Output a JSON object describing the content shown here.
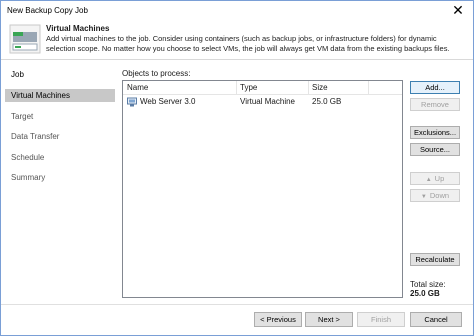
{
  "window": {
    "title": "New Backup Copy Job"
  },
  "header": {
    "title": "Virtual Machines",
    "description": "Add virtual machines to the job. Consider using containers (such as backup jobs, or infrastructure folders) for dynamic selection scope. No matter how you choose to select VMs, the job will always get VM data from the existing backups files."
  },
  "sidebar": {
    "items": [
      {
        "label": "Job"
      },
      {
        "label": "Virtual Machines"
      },
      {
        "label": "Target"
      },
      {
        "label": "Data Transfer"
      },
      {
        "label": "Schedule"
      },
      {
        "label": "Summary"
      }
    ]
  },
  "objects": {
    "label": "Objects to process:",
    "columns": [
      "Name",
      "Type",
      "Size"
    ],
    "rows": [
      {
        "name": "Web Server 3.0",
        "type": "Virtual Machine",
        "size": "25.0 GB"
      }
    ]
  },
  "side_buttons": {
    "add": "Add...",
    "remove": "Remove",
    "exclusions": "Exclusions...",
    "source": "Source...",
    "up": "Up",
    "down": "Down",
    "recalculate": "Recalculate"
  },
  "total": {
    "label": "Total size:",
    "value": "25.0 GB"
  },
  "footer": {
    "previous": "< Previous",
    "next": "Next >",
    "finish": "Finish",
    "cancel": "Cancel"
  },
  "colors": {
    "active_item": "#c8c8c8",
    "accent_border": "#3c7fb1",
    "icon_green": "#3aa655"
  },
  "icons": {
    "close": "close-icon",
    "header": "vm-group-icon",
    "vm": "vm-icon",
    "up": "arrow-up-icon",
    "down": "arrow-down-icon"
  }
}
